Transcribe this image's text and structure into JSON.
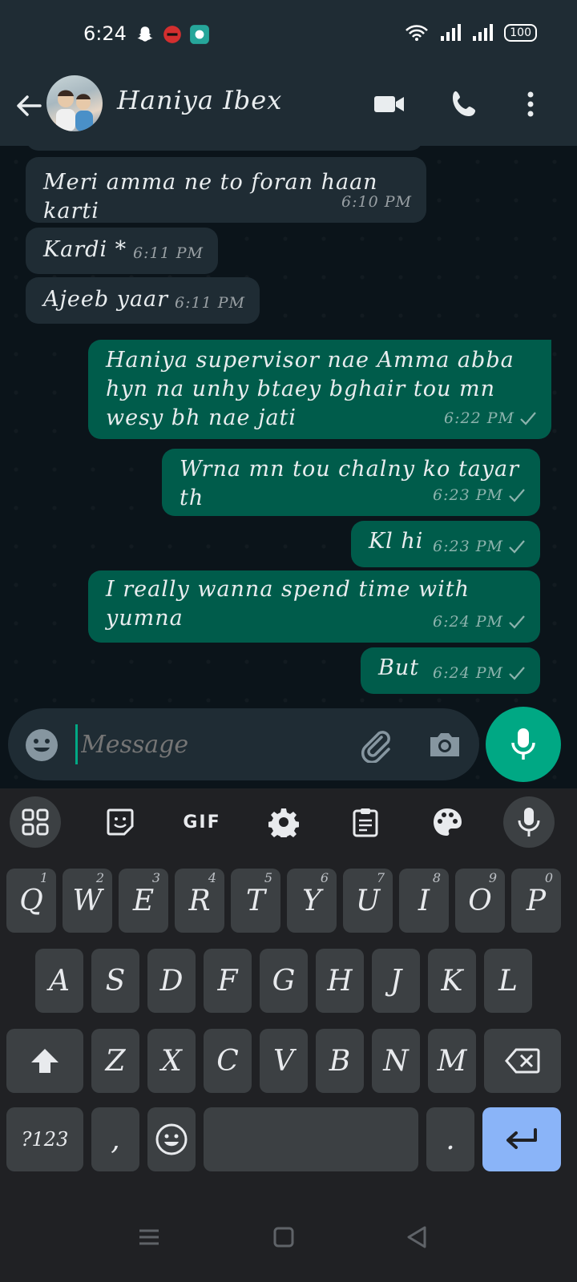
{
  "status_bar": {
    "time": "6:24",
    "battery": "100"
  },
  "header": {
    "contact_name": "Haniya Ibex"
  },
  "messages": [
    {
      "dir": "in",
      "lines": [
        "Meri amma ne to foran haan karti"
      ],
      "time": "6:10 PM"
    },
    {
      "dir": "in",
      "lines": [
        "Kardi *"
      ],
      "time": "6:11 PM"
    },
    {
      "dir": "in",
      "lines": [
        "Ajeeb yaar"
      ],
      "time": "6:11 PM"
    },
    {
      "dir": "out",
      "lines": [
        "Haniya supervisor nae Amma abba",
        "hyn na unhy btaey bghair tou mn",
        "wesy bh nae jati"
      ],
      "time": "6:22 PM"
    },
    {
      "dir": "out",
      "lines": [
        "Wrna mn tou chalny ko tayar th"
      ],
      "time": "6:23 PM"
    },
    {
      "dir": "out",
      "lines": [
        "Kl hi"
      ],
      "time": "6:23 PM"
    },
    {
      "dir": "out",
      "lines": [
        "I really wanna spend time with",
        "yumna"
      ],
      "time": "6:24 PM"
    },
    {
      "dir": "out",
      "lines": [
        "But"
      ],
      "time": "6:24 PM"
    }
  ],
  "composer": {
    "placeholder": "Message"
  },
  "keyboard": {
    "toolbar": {
      "gif": "GIF"
    },
    "row1": [
      {
        "key": "Q",
        "hint": "1"
      },
      {
        "key": "W",
        "hint": "2"
      },
      {
        "key": "E",
        "hint": "3"
      },
      {
        "key": "R",
        "hint": "4"
      },
      {
        "key": "T",
        "hint": "5"
      },
      {
        "key": "Y",
        "hint": "6"
      },
      {
        "key": "U",
        "hint": "7"
      },
      {
        "key": "I",
        "hint": "8"
      },
      {
        "key": "O",
        "hint": "9"
      },
      {
        "key": "P",
        "hint": "0"
      }
    ],
    "row2": [
      "A",
      "S",
      "D",
      "F",
      "G",
      "H",
      "J",
      "K",
      "L"
    ],
    "row3": [
      "Z",
      "X",
      "C",
      "V",
      "B",
      "N",
      "M"
    ],
    "symbols": "?123",
    "comma": ",",
    "period": "."
  },
  "icons": {
    "back": "arrow-left",
    "video": "video-camera",
    "call": "phone",
    "menu": "more-vertical",
    "emoji": "smiley",
    "attach": "paperclip",
    "camera": "camera",
    "mic": "microphone"
  },
  "colors": {
    "outgoing": "#005c4b",
    "incoming": "#1f2c34",
    "accent": "#00a884",
    "enter": "#8ab4f8"
  }
}
